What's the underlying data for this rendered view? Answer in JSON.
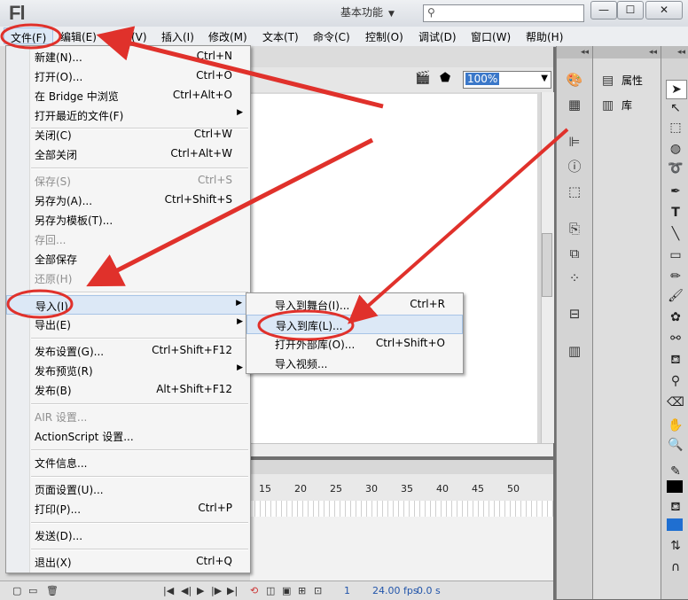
{
  "app": {
    "logo": "Fl"
  },
  "titlebar": {
    "workspace": "基本功能",
    "search_placeholder": "",
    "min": "—",
    "max": "☐",
    "close": "✕"
  },
  "menubar": [
    {
      "label": "文件(F)"
    },
    {
      "label": "编辑(E)"
    },
    {
      "label": "视图(V)"
    },
    {
      "label": "插入(I)"
    },
    {
      "label": "修改(M)"
    },
    {
      "label": "文本(T)"
    },
    {
      "label": "命令(C)"
    },
    {
      "label": "控制(O)"
    },
    {
      "label": "调试(D)"
    },
    {
      "label": "窗口(W)"
    },
    {
      "label": "帮助(H)"
    }
  ],
  "file_menu": {
    "items": [
      {
        "label": "新建(N)...",
        "shortcut": "Ctrl+N"
      },
      {
        "label": "打开(O)...",
        "shortcut": "Ctrl+O"
      },
      {
        "label": "在 Bridge 中浏览",
        "shortcut": "Ctrl+Alt+O"
      },
      {
        "label": "打开最近的文件(F)",
        "shortcut": ""
      },
      {
        "label": "关闭(C)",
        "shortcut": "Ctrl+W"
      },
      {
        "label": "全部关闭",
        "shortcut": "Ctrl+Alt+W"
      },
      {
        "label": "保存(S)",
        "shortcut": "Ctrl+S"
      },
      {
        "label": "另存为(A)...",
        "shortcut": "Ctrl+Shift+S"
      },
      {
        "label": "另存为模板(T)...",
        "shortcut": ""
      },
      {
        "label": "存回...",
        "shortcut": ""
      },
      {
        "label": "全部保存",
        "shortcut": ""
      },
      {
        "label": "还原(H)",
        "shortcut": ""
      },
      {
        "label": "导入(I)",
        "shortcut": ""
      },
      {
        "label": "导出(E)",
        "shortcut": ""
      },
      {
        "label": "发布设置(G)...",
        "shortcut": "Ctrl+Shift+F12"
      },
      {
        "label": "发布预览(R)",
        "shortcut": ""
      },
      {
        "label": "发布(B)",
        "shortcut": "Alt+Shift+F12"
      },
      {
        "label": "AIR 设置...",
        "shortcut": ""
      },
      {
        "label": "ActionScript 设置...",
        "shortcut": ""
      },
      {
        "label": "文件信息...",
        "shortcut": ""
      },
      {
        "label": "页面设置(U)...",
        "shortcut": ""
      },
      {
        "label": "打印(P)...",
        "shortcut": "Ctrl+P"
      },
      {
        "label": "发送(D)...",
        "shortcut": ""
      },
      {
        "label": "退出(X)",
        "shortcut": "Ctrl+Q"
      }
    ]
  },
  "import_submenu": {
    "items": [
      {
        "label": "导入到舞台(I)...",
        "shortcut": "Ctrl+R"
      },
      {
        "label": "导入到库(L)...",
        "shortcut": ""
      },
      {
        "label": "打开外部库(O)...",
        "shortcut": "Ctrl+Shift+O"
      },
      {
        "label": "导入视频...",
        "shortcut": ""
      }
    ]
  },
  "document": {
    "zoom": "100%"
  },
  "timeline": {
    "ruler": [
      "15",
      "20",
      "25",
      "30",
      "35",
      "40",
      "45",
      "50"
    ],
    "frame": "1",
    "fps": "24.00 fps",
    "time": "0.0 s"
  },
  "panels": {
    "properties": "属性",
    "library": "库"
  },
  "colors": {
    "menu_highlight": "#dce8f6",
    "annotation_red": "#e0312b",
    "fill_swatch": "#1f6fd1"
  }
}
